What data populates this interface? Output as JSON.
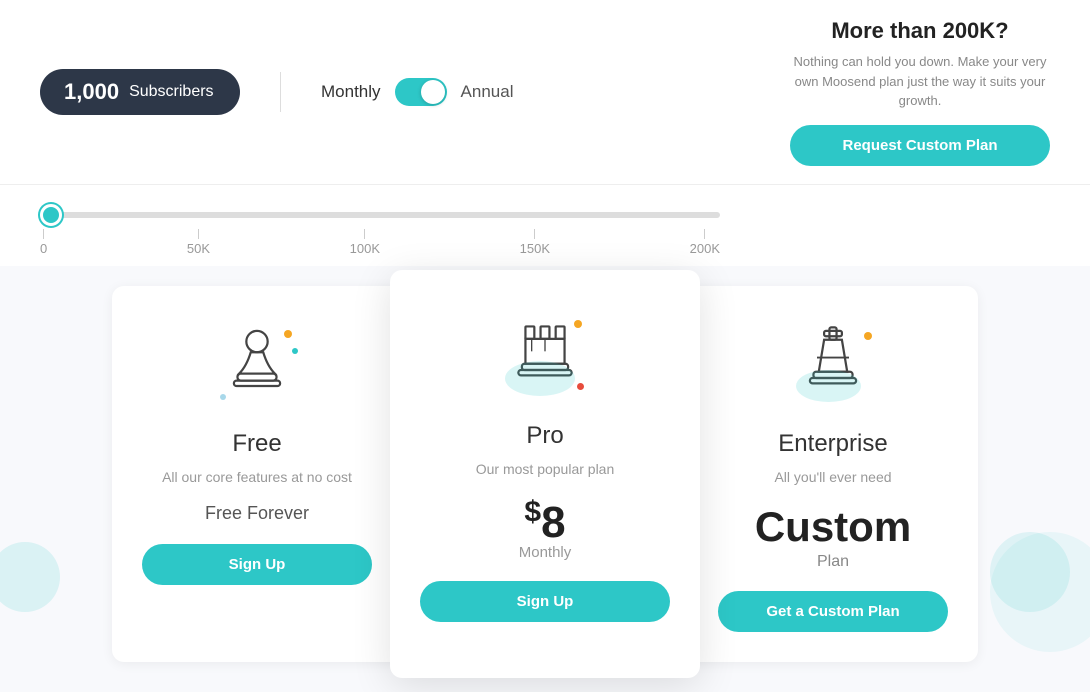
{
  "header": {
    "subscribers_count": "1,000",
    "subscribers_label": "Subscribers",
    "billing_monthly": "Monthly",
    "billing_annual": "Annual",
    "custom_title": "More than 200K?",
    "custom_desc": "Nothing can hold you down. Make your very own Moosend plan just the way it suits your growth.",
    "request_btn": "Request Custom Plan"
  },
  "slider": {
    "ticks": [
      "0",
      "50K",
      "100K",
      "150K",
      "200K"
    ],
    "value": 0
  },
  "plans": [
    {
      "id": "free",
      "title": "Free",
      "subtitle": "All our core features at no cost",
      "price_label": "Free Forever",
      "cta": "Sign Up"
    },
    {
      "id": "pro",
      "title": "Pro",
      "subtitle": "Our most popular plan",
      "price_dollar": "$",
      "price_amount": "8",
      "price_period": "Monthly",
      "cta": "Sign Up"
    },
    {
      "id": "enterprise",
      "title": "Enterprise",
      "subtitle": "All you'll ever need",
      "price_label": "Custom",
      "plan_label": "Plan",
      "cta": "Get a Custom Plan"
    }
  ]
}
